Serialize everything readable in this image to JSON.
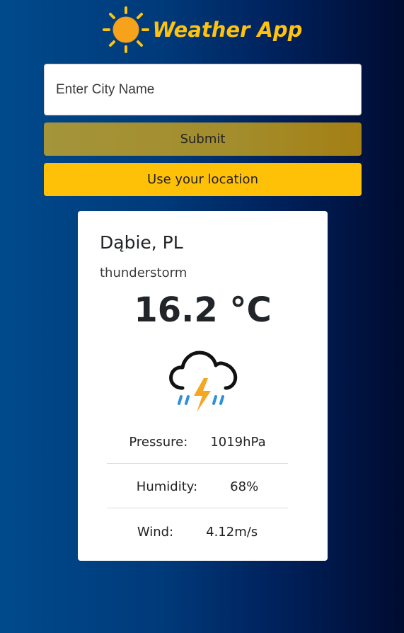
{
  "header": {
    "title": "Weather App",
    "logo_icon": "sun-icon",
    "title_color": "#ffc20e"
  },
  "search": {
    "placeholder": "Enter City Name",
    "value": ""
  },
  "buttons": {
    "submit_label": "Submit",
    "location_label": "Use your location"
  },
  "weather": {
    "location": "Dąbie, PL",
    "condition": "thunderstorm",
    "temperature": "16.2 °C",
    "icon": "thunderstorm-icon",
    "details": [
      {
        "label": "Pressure:",
        "value": "1019hPa"
      },
      {
        "label": "Humidity:",
        "value": "68%"
      },
      {
        "label": "Wind:",
        "value": "4.12m/s"
      }
    ]
  },
  "colors": {
    "accent": "#ffc107",
    "submit_bg": "#a4902a",
    "card_bg": "#ffffff",
    "background_left": "#004a8c",
    "background_right": "#000b30"
  }
}
